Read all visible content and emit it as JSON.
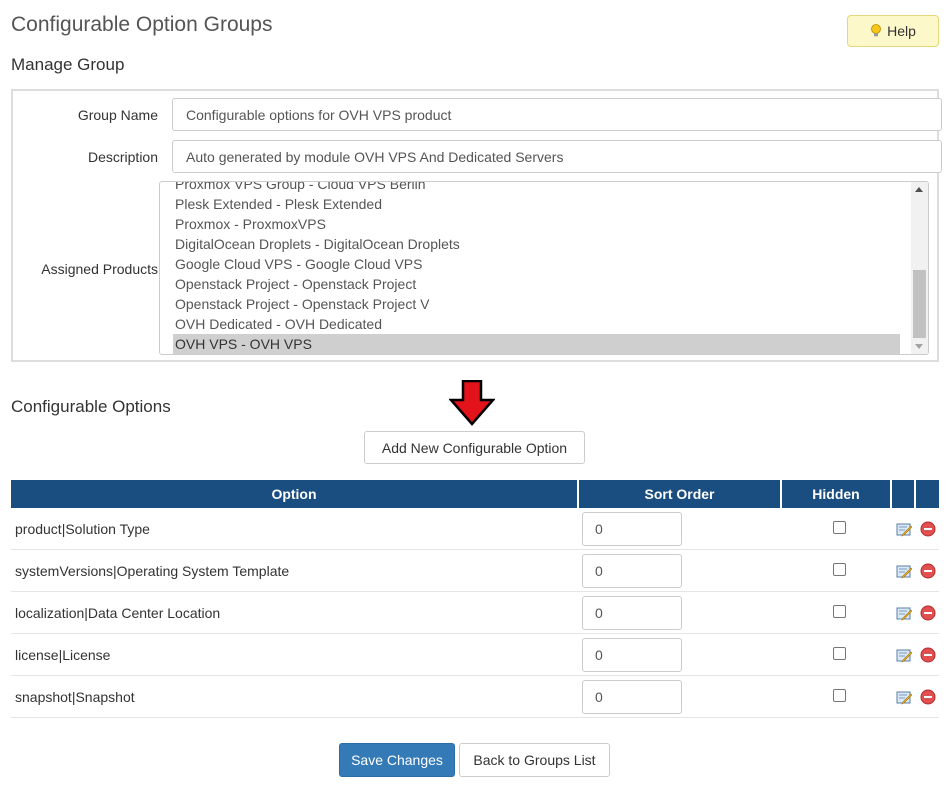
{
  "header": {
    "title": "Configurable Option Groups",
    "help_label": "Help"
  },
  "manage_group": {
    "section_title": "Manage Group",
    "group_name_label": "Group Name",
    "group_name_value": "Configurable options for OVH VPS product",
    "description_label": "Description",
    "description_value": "Auto generated by module OVH VPS And Dedicated Servers",
    "assigned_products_label": "Assigned Products",
    "assigned_products": [
      "Proxmox VPS Group - Cloud VPS Berlin",
      "Plesk Extended - Plesk Extended",
      "Proxmox - ProxmoxVPS",
      "DigitalOcean Droplets - DigitalOcean Droplets",
      "Google Cloud VPS - Google Cloud VPS",
      "Openstack Project - Openstack Project",
      "Openstack Project - Openstack Project V",
      "OVH Dedicated - OVH Dedicated",
      "OVH VPS - OVH VPS"
    ],
    "selected_product": "OVH VPS - OVH VPS"
  },
  "configurable_options": {
    "section_title": "Configurable Options",
    "add_button_label": "Add New Configurable Option",
    "columns": [
      "Option",
      "Sort Order",
      "Hidden",
      "",
      ""
    ],
    "rows": [
      {
        "option": "product|Solution Type",
        "sort_order": "0",
        "hidden": false
      },
      {
        "option": "systemVersions|Operating System Template",
        "sort_order": "0",
        "hidden": false
      },
      {
        "option": "localization|Data Center Location",
        "sort_order": "0",
        "hidden": false
      },
      {
        "option": "license|License",
        "sort_order": "0",
        "hidden": false
      },
      {
        "option": "snapshot|Snapshot",
        "sort_order": "0",
        "hidden": false
      }
    ]
  },
  "footer": {
    "save_label": "Save Changes",
    "back_label": "Back to Groups List"
  },
  "colors": {
    "table_header_bg": "#1a4d80",
    "primary_button": "#337ab7",
    "help_button_bg": "#fcf8c9",
    "annotation_arrow": "#e3131b"
  }
}
